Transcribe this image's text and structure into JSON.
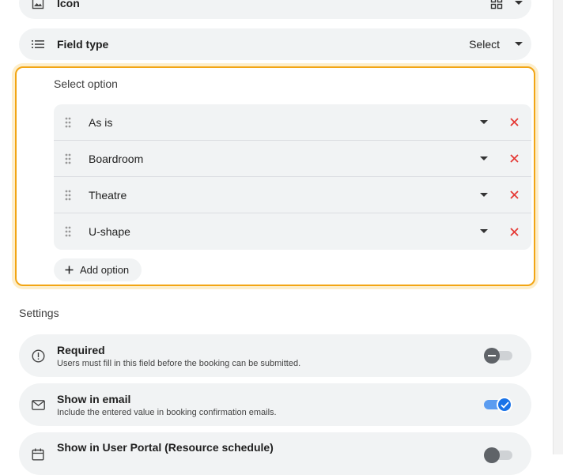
{
  "top_rows": {
    "icon_row": {
      "label": "Icon",
      "icon": "image-icon",
      "value_icon": "grid-icon"
    },
    "field_type_row": {
      "label": "Field type",
      "icon": "list-icon",
      "value": "Select"
    }
  },
  "select_option": {
    "heading": "Select option",
    "options": [
      {
        "label": "As is"
      },
      {
        "label": "Boardroom"
      },
      {
        "label": "Theatre"
      },
      {
        "label": "U-shape"
      }
    ],
    "add_label": "Add option"
  },
  "settings": {
    "heading": "Settings",
    "items": [
      {
        "title": "Required",
        "subtitle": "Users must fill in this field before the booking can be submitted.",
        "icon": "alert-circle-icon",
        "enabled": false
      },
      {
        "title": "Show in email",
        "subtitle": "Include the entered value in booking confirmation emails.",
        "icon": "mail-icon",
        "enabled": true
      },
      {
        "title": "Show in User Portal (Resource schedule)",
        "subtitle": "",
        "icon": "calendar-icon",
        "enabled": false
      }
    ]
  },
  "colors": {
    "accent": "#1a73e8",
    "highlight_border": "#f2a514",
    "remove": "#e53935"
  }
}
